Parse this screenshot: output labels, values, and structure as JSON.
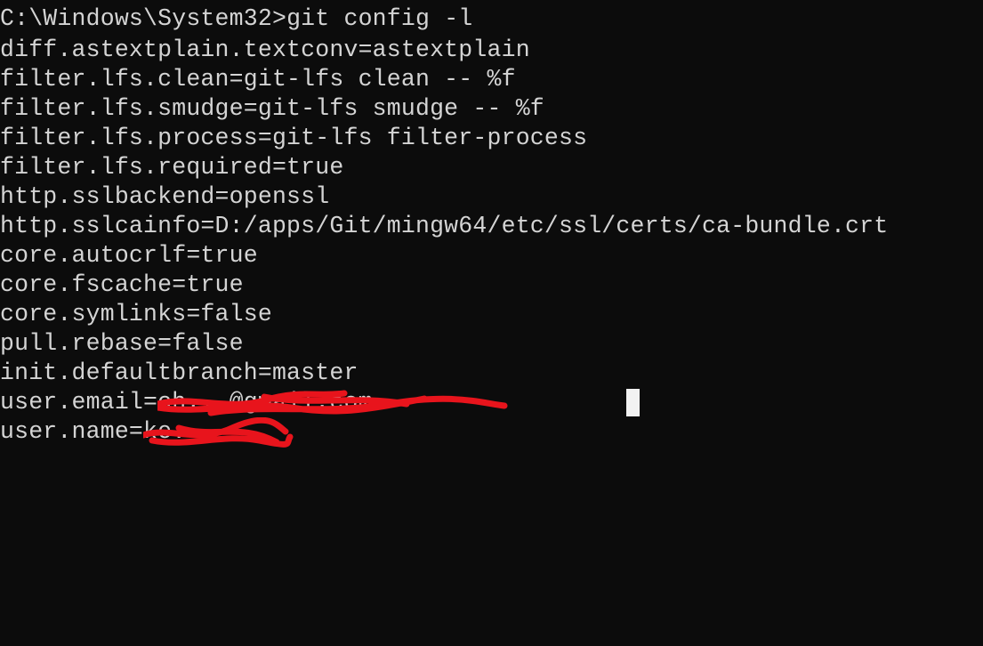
{
  "terminal": {
    "prompt": "C:\\Windows\\System32>",
    "command": "git config -l",
    "output_lines": [
      "diff.astextplain.textconv=astextplain",
      "filter.lfs.clean=git-lfs clean -- %f",
      "filter.lfs.smudge=git-lfs smudge -- %f",
      "filter.lfs.process=git-lfs filter-process",
      "filter.lfs.required=true",
      "http.sslbackend=openssl",
      "http.sslcainfo=D:/apps/Git/mingw64/etc/ssl/certs/ca-bundle.crt",
      "core.autocrlf=true",
      "core.fscache=true",
      "core.symlinks=false",
      "pull.rebase=false",
      "init.defaultbranch=master"
    ],
    "email_key": "user.email=",
    "email_value_redacted": "ch...@gmail.com",
    "name_key": "user.name=",
    "name_value_redacted": "ke...",
    "redaction_color": "#e8141c",
    "background_color": "#0c0c0c",
    "text_color": "#d4d4d4",
    "cursor_icon": "block-cursor"
  }
}
